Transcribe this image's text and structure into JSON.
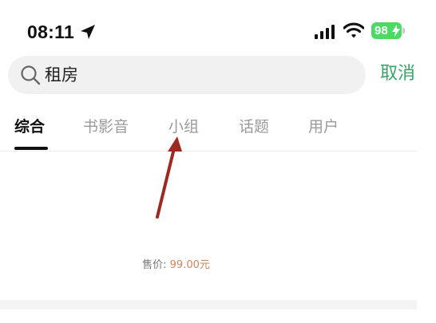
{
  "status_bar": {
    "time": "08:11",
    "battery_level": "98",
    "icons": [
      "location-arrow-icon",
      "signal-icon",
      "wifi-icon",
      "battery-icon",
      "charging-bolt-icon"
    ]
  },
  "search": {
    "query": "租房",
    "cancel_label": "取消"
  },
  "tabs": [
    {
      "label": "综合",
      "active": true
    },
    {
      "label": "书影音",
      "active": false
    },
    {
      "label": "小组",
      "active": false
    },
    {
      "label": "话题",
      "active": false
    },
    {
      "label": "用户",
      "active": false
    }
  ],
  "price": {
    "label": "售价:",
    "value": "99.00元"
  },
  "colors": {
    "accent_green": "#3aa36a",
    "battery_green": "#4cd964",
    "arrow_red": "#9b2b22",
    "price_orange": "#d2835a"
  }
}
